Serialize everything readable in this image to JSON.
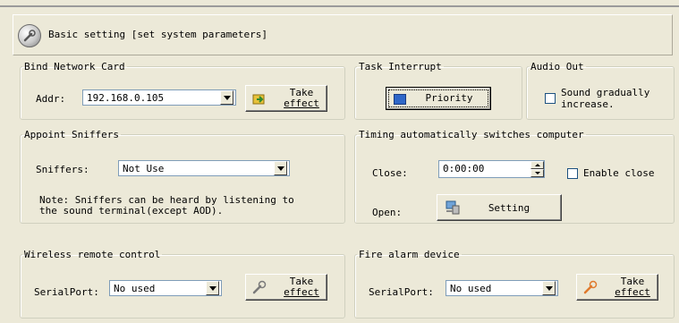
{
  "header": {
    "title": "Basic setting [set system parameters]",
    "icon": "wrench-icon"
  },
  "bind_network_card": {
    "legend": "Bind Network Card",
    "addr_label": "Addr:",
    "addr_value": "192.168.0.105",
    "take_effect_line1": "Take",
    "take_effect_line2": "effect"
  },
  "task_interrupt": {
    "legend": "Task Interrupt",
    "priority_label": "Priority"
  },
  "audio_out": {
    "legend": "Audio Out",
    "checkbox_line1": "Sound gradually",
    "checkbox_line2": "increase.",
    "checked": false
  },
  "appoint_sniffers": {
    "legend": "Appoint Sniffers",
    "sniffers_label": "Sniffers:",
    "sniffers_value": "Not Use",
    "note_line1": "Note: Sniffers can be heard by listening to",
    "note_line2": "the sound terminal(except AOD)."
  },
  "timing": {
    "legend": "Timing automatically switches computer",
    "close_label": "Close:",
    "close_value": "0:00:00",
    "enable_close_label": "Enable close",
    "enable_close_checked": false,
    "open_label": "Open:",
    "setting_label": "Setting"
  },
  "wireless": {
    "legend": "Wireless remote control",
    "serialport_label": "SerialPort:",
    "serialport_value": "No used",
    "take_effect_line1": "Take",
    "take_effect_line2": "effect"
  },
  "fire_alarm": {
    "legend": "Fire alarm device",
    "serialport_label": "SerialPort:",
    "serialport_value": "No used",
    "take_effect_line1": "Take",
    "take_effect_line2": "effect"
  }
}
